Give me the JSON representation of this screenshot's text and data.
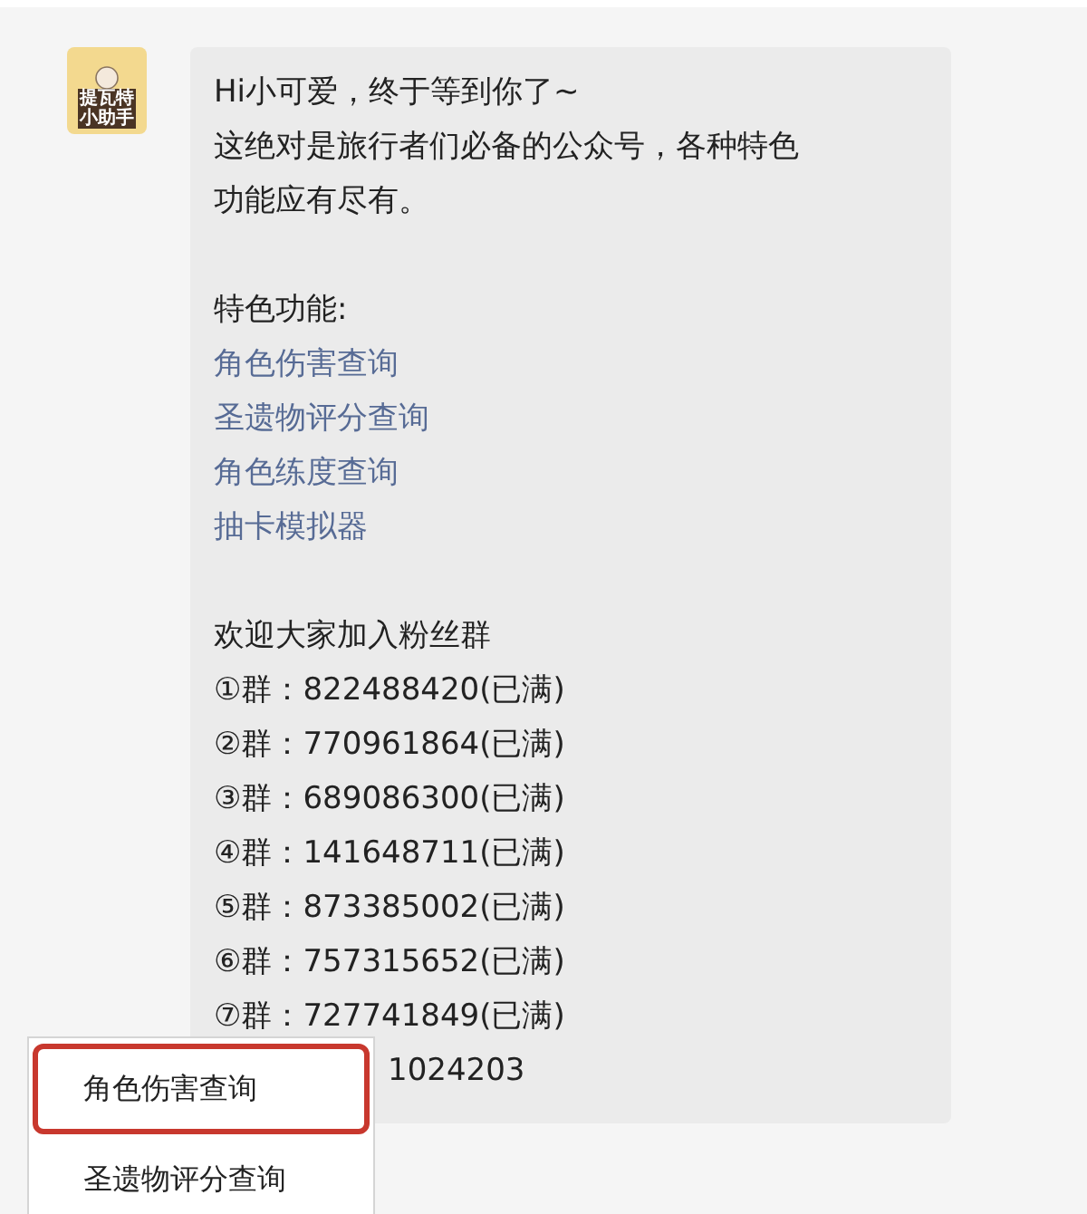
{
  "avatar": {
    "lines": [
      "提瓦特",
      "小助手"
    ]
  },
  "message": {
    "greeting": "Hi小可爱，终于等到你了~",
    "intro": [
      "这绝对是旅行者们必备的公众号，各种特色",
      "功能应有尽有。"
    ],
    "features_heading": "特色功能:",
    "features": [
      "角色伤害查询",
      "圣遗物评分查询",
      "角色练度查询",
      "抽卡模拟器"
    ],
    "groups_heading": "欢迎大家加入粉丝群",
    "groups": [
      "①群：822488420(已满)",
      "②群：770961864(已满)",
      "③群：689086300(已满)",
      "④群：141648711(已满)",
      "⑤群：873385002(已满)",
      "⑥群：757315652(已满)",
      "⑦群：727741849(已满)"
    ],
    "last_line": "1024203"
  },
  "context_menu": {
    "items": [
      {
        "label": "角色伤害查询",
        "selected": true
      },
      {
        "label": "圣遗物评分查询",
        "selected": false
      }
    ]
  }
}
